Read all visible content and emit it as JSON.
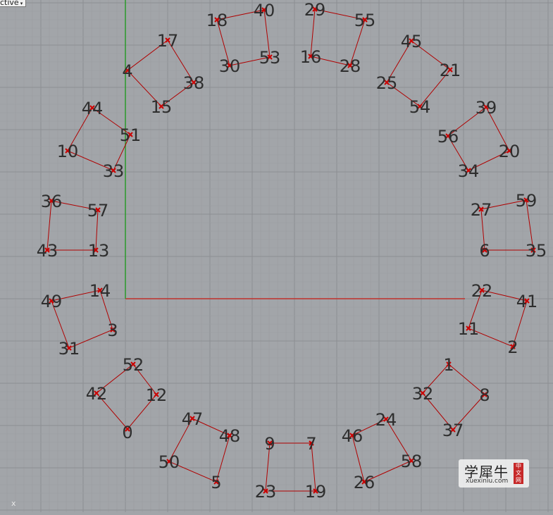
{
  "viewport": {
    "tab_label": "ctive",
    "tab_arrow": "▾",
    "background": "#a2a5a9",
    "grid_minor_color": "#9a9da1",
    "grid_major_color": "#8c8f93",
    "x_axis_color": "#c0302a",
    "y_axis_color": "#2a9a2a",
    "axis_corner_label": "x"
  },
  "polygons": {
    "line_color": "#b00000",
    "marker_color": "#cc0000",
    "label_color": "#2e2e2e",
    "shapes": [
      [
        "17",
        "38",
        "15",
        "4"
      ],
      [
        "18",
        "40",
        "53",
        "30"
      ],
      [
        "29",
        "55",
        "28",
        "16"
      ],
      [
        "45",
        "21",
        "54",
        "25"
      ],
      [
        "44",
        "51",
        "33",
        "10"
      ],
      [
        "39",
        "20",
        "34",
        "56"
      ],
      [
        "36",
        "57",
        "13",
        "43"
      ],
      [
        "27",
        "59",
        "35",
        "6"
      ],
      [
        "49",
        "14",
        "3",
        "31"
      ],
      [
        "22",
        "41",
        "2",
        "11"
      ],
      [
        "52",
        "12",
        "0",
        "42"
      ],
      [
        "1",
        "8",
        "37",
        "32"
      ],
      [
        "47",
        "48",
        "5",
        "50"
      ],
      [
        "9",
        "7",
        "19",
        "23"
      ],
      [
        "46",
        "24",
        "58",
        "26"
      ]
    ]
  },
  "watermark": {
    "cn_text": "学犀牛",
    "badge": "中文网",
    "url": "xuexiniu.com"
  }
}
